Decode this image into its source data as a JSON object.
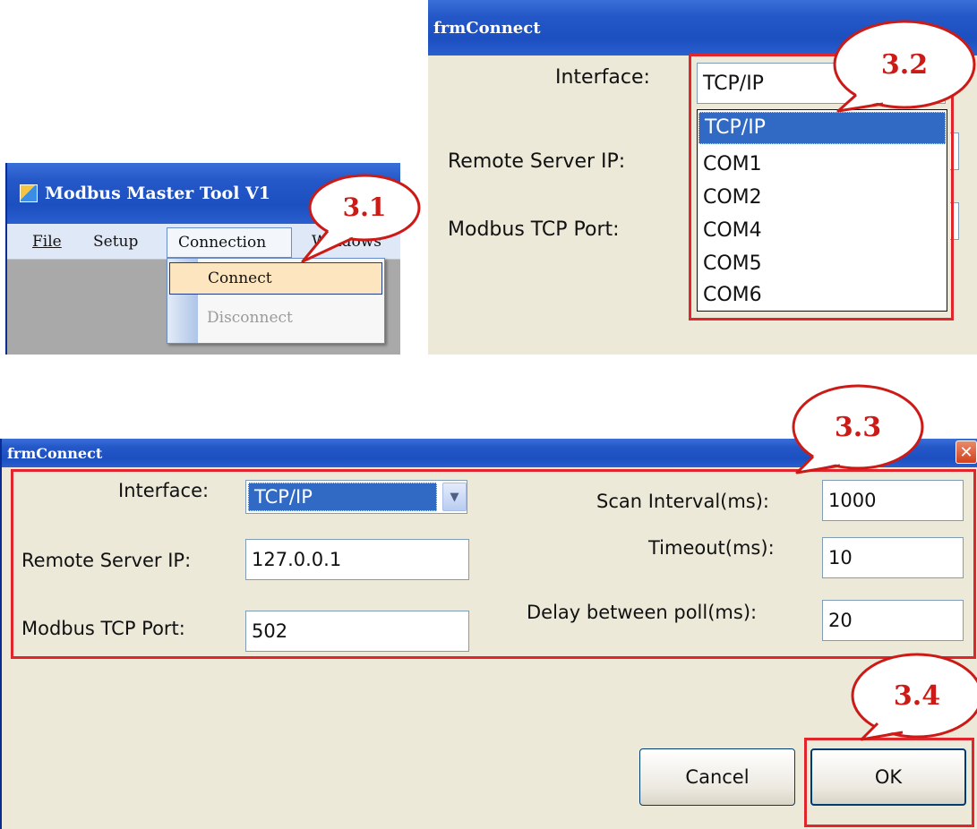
{
  "panel_a": {
    "title": "Modbus Master Tool V1",
    "menu": [
      {
        "label": "File"
      },
      {
        "label": "Setup"
      },
      {
        "label": "Connection"
      },
      {
        "label": "Windows"
      }
    ],
    "dropdown": [
      {
        "label": "Connect",
        "enabled": true,
        "highlighted": true
      },
      {
        "label": "Disconnect",
        "enabled": false,
        "highlighted": false
      }
    ],
    "step_label": "3.1"
  },
  "panel_b": {
    "title": "frmConnect",
    "interface_label": "Interface:",
    "interface_value": "TCP/IP",
    "remote_ip_label": "Remote Server IP:",
    "tcp_port_label": "Modbus TCP Port:",
    "interface_options": [
      "TCP/IP",
      "COM1",
      "COM2",
      "COM4",
      "COM5",
      "COM6"
    ],
    "selected_option": "TCP/IP",
    "step_label": "3.2"
  },
  "panel_c": {
    "title": "frmConnect",
    "close_icon": "close-icon",
    "interface_label": "Interface:",
    "interface_value": "TCP/IP",
    "remote_ip_label": "Remote Server IP:",
    "remote_ip_value": "127.0.0.1",
    "tcp_port_label": "Modbus TCP Port:",
    "tcp_port_value": "502",
    "scan_interval_label": "Scan Interval(ms):",
    "scan_interval_value": "1000",
    "timeout_label": "Timeout(ms):",
    "timeout_value": "10",
    "delay_label": "Delay between poll(ms):",
    "delay_value": "20",
    "cancel_label": "Cancel",
    "ok_label": "OK",
    "step_label_settings": "3.3",
    "step_label_ok": "3.4"
  },
  "colors": {
    "accent_red": "#e0262c",
    "callout_text": "#cc1b17",
    "xp_title_blue": "#2457c7",
    "panel_bg": "#ece9d8",
    "selection_blue": "#316ac5"
  }
}
